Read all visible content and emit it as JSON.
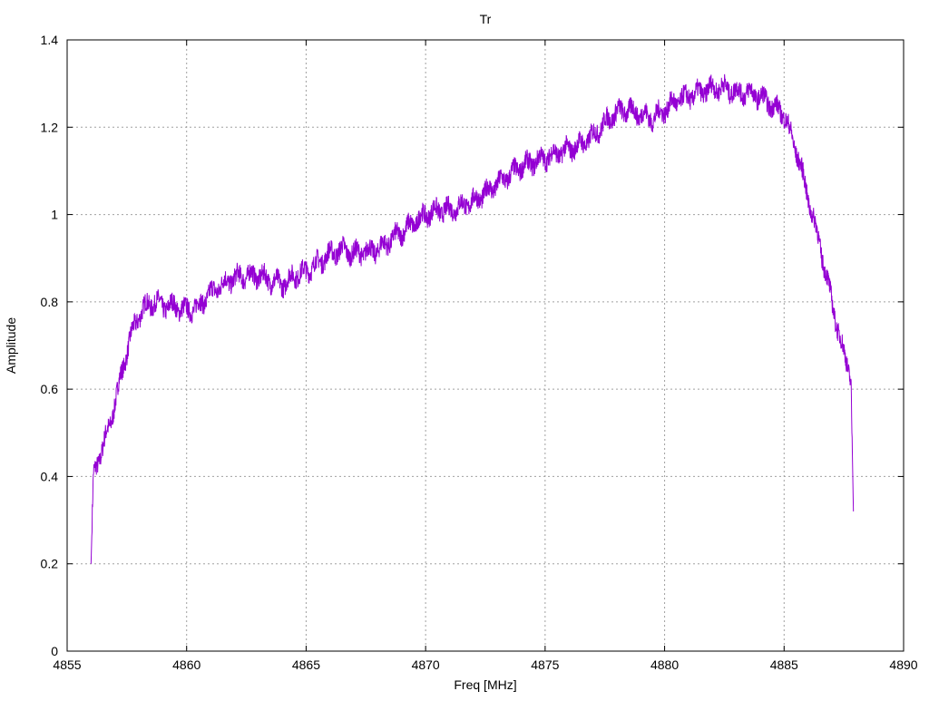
{
  "chart_data": {
    "type": "line",
    "title": "Tr",
    "xlabel": "Freq [MHz]",
    "ylabel": "Amplitude",
    "xlim": [
      4855,
      4890
    ],
    "ylim": [
      0,
      1.4
    ],
    "xticks": [
      "4855",
      "4860",
      "4865",
      "4870",
      "4875",
      "4880",
      "4885",
      "4890"
    ],
    "yticks": [
      "0",
      "0.2",
      "0.4",
      "0.6",
      "0.8",
      "1",
      "1.2",
      "1.4"
    ],
    "grid": true,
    "legend": "none",
    "series": [
      {
        "name": "Tr",
        "color": "#9400d3",
        "x": [
          4856.0,
          4856.1,
          4856.2,
          4856.5,
          4856.8,
          4857.0,
          4857.3,
          4857.6,
          4858.0,
          4858.3,
          4858.7,
          4859.0,
          4859.5,
          4860.0,
          4860.5,
          4861.0,
          4861.5,
          4862.0,
          4862.5,
          4863.0,
          4863.5,
          4864.0,
          4864.5,
          4865.0,
          4865.5,
          4866.0,
          4866.5,
          4867.0,
          4867.5,
          4868.0,
          4868.5,
          4869.0,
          4869.5,
          4870.0,
          4870.5,
          4871.0,
          4871.5,
          4872.0,
          4872.5,
          4873.0,
          4873.5,
          4874.0,
          4874.5,
          4875.0,
          4875.5,
          4876.0,
          4876.5,
          4877.0,
          4877.5,
          4878.0,
          4878.5,
          4879.0,
          4879.5,
          4880.0,
          4880.5,
          4881.0,
          4881.5,
          4882.0,
          4882.5,
          4883.0,
          4883.5,
          4884.0,
          4884.5,
          4885.0,
          4885.3,
          4885.6,
          4886.0,
          4886.5,
          4887.0,
          4887.4,
          4887.7,
          4887.8,
          4887.9
        ],
        "y": [
          0.2,
          0.4,
          0.42,
          0.47,
          0.52,
          0.57,
          0.64,
          0.71,
          0.77,
          0.79,
          0.8,
          0.79,
          0.79,
          0.78,
          0.79,
          0.82,
          0.84,
          0.855,
          0.86,
          0.86,
          0.85,
          0.84,
          0.86,
          0.87,
          0.89,
          0.91,
          0.92,
          0.91,
          0.915,
          0.92,
          0.94,
          0.96,
          0.98,
          1.0,
          1.01,
          1.01,
          1.02,
          1.03,
          1.05,
          1.07,
          1.09,
          1.11,
          1.12,
          1.13,
          1.14,
          1.15,
          1.16,
          1.18,
          1.21,
          1.235,
          1.24,
          1.23,
          1.22,
          1.24,
          1.26,
          1.27,
          1.28,
          1.29,
          1.29,
          1.28,
          1.28,
          1.27,
          1.25,
          1.23,
          1.18,
          1.13,
          1.04,
          0.93,
          0.8,
          0.7,
          0.65,
          0.62,
          0.32
        ]
      }
    ]
  }
}
